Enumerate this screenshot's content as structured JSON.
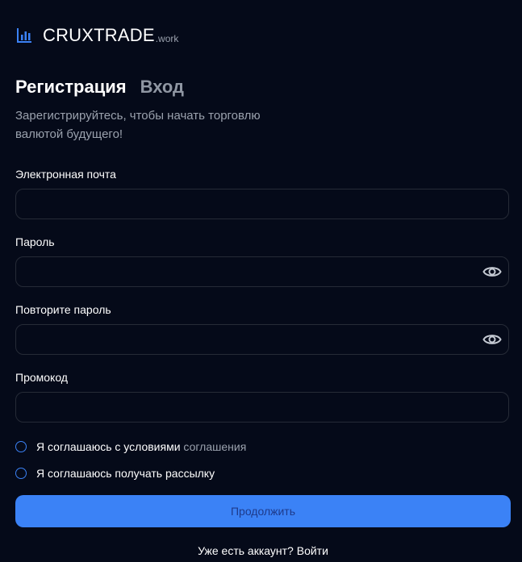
{
  "brand": {
    "name": "CRUXTRADE",
    "suffix": ".work",
    "logo_icon": "bar-chart-icon",
    "accent_color": "#3b82f6"
  },
  "tabs": [
    {
      "label": "Регистрация",
      "active": true
    },
    {
      "label": "Вход",
      "active": false
    }
  ],
  "subtitle": "Зарегистрируйтесь, чтобы начать торговлю валютой будущего!",
  "form": {
    "email": {
      "label": "Электронная почта",
      "value": "",
      "placeholder": ""
    },
    "password": {
      "label": "Пароль",
      "value": "",
      "placeholder": "",
      "toggle_icon": "eye-icon"
    },
    "repeat_password": {
      "label": "Повторите пароль",
      "value": "",
      "placeholder": "",
      "toggle_icon": "eye-icon"
    },
    "promo": {
      "label": "Промокод",
      "value": "",
      "placeholder": ""
    }
  },
  "agreements": {
    "terms_prefix": "Я соглашаюсь с условиями",
    "terms_link": "соглашения",
    "terms_checked": false,
    "newsletter": "Я соглашаюсь получать рассылку",
    "newsletter_checked": false
  },
  "submit_label": "Продолжить",
  "footer": {
    "text": "Уже есть аккаунт?",
    "link": "Войти"
  }
}
